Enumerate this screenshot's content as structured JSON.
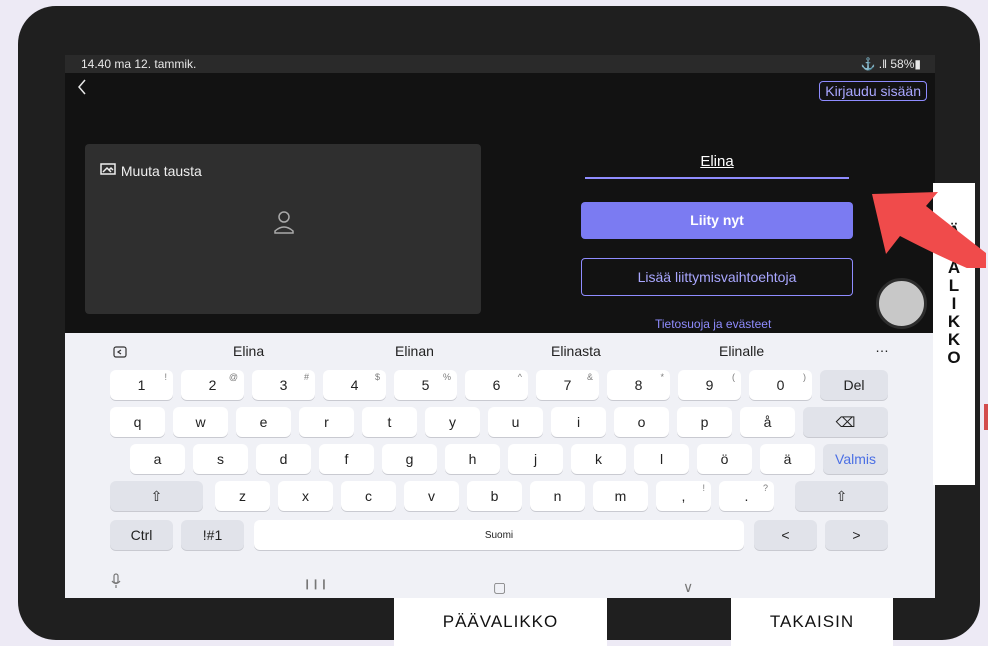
{
  "status": {
    "time_date": "14.40  ma 12. tammik.",
    "battery": "⚓ .‖ 58%▮"
  },
  "header": {
    "back_icon": "chevron-left-icon",
    "login_label": "Kirjaudu sisään"
  },
  "preview": {
    "background_label": "Muuta tausta",
    "background_icon": "background-icon",
    "avatar_icon": "person-icon"
  },
  "form": {
    "name_value": "Elina",
    "join_label": "Liity nyt",
    "more_options_label": "Lisää liittymisvaihtoehtoja",
    "privacy_label": "Tietosuoja ja evästeet"
  },
  "keyboard": {
    "suggestions": [
      "Elina",
      "Elinan",
      "Elinasta",
      "Elinalle"
    ],
    "more_icon": "…",
    "numbers": [
      "1",
      "2",
      "3",
      "4",
      "5",
      "6",
      "7",
      "8",
      "9",
      "0"
    ],
    "number_sups": [
      "!",
      "@",
      "#",
      "$",
      "%",
      "^",
      "&",
      "*",
      "(",
      ")"
    ],
    "del_label": "Del",
    "row1": [
      "q",
      "w",
      "e",
      "r",
      "t",
      "y",
      "u",
      "i",
      "o",
      "p",
      "å"
    ],
    "backspace_icon": "⌫",
    "row2": [
      "a",
      "s",
      "d",
      "f",
      "g",
      "h",
      "j",
      "k",
      "l",
      "ö",
      "ä"
    ],
    "done_label": "Valmis",
    "shift_icon": "⇧",
    "row3": [
      "z",
      "x",
      "c",
      "v",
      "b",
      "n",
      "m",
      ",",
      "."
    ],
    "row3_sups": [
      "",
      "",
      "",
      "",
      "",
      "",
      "",
      "!",
      "?"
    ],
    "ctrl_label": "Ctrl",
    "symbol_label": "!#1",
    "space_label": "Suomi",
    "left_arrow": "<",
    "right_arrow": ">",
    "nav_icons": [
      "❙❙❙",
      "▢",
      "∨"
    ]
  },
  "side_label": "Ä\nV\nA\nL\nI\nK\nK\nO",
  "bottom_labels": {
    "paavalikko": "PÄÄVALIKKO",
    "takaisin": "TAKAISIN"
  },
  "colors": {
    "accent": "#7b7bf2",
    "arrow": "#f04b4b"
  }
}
